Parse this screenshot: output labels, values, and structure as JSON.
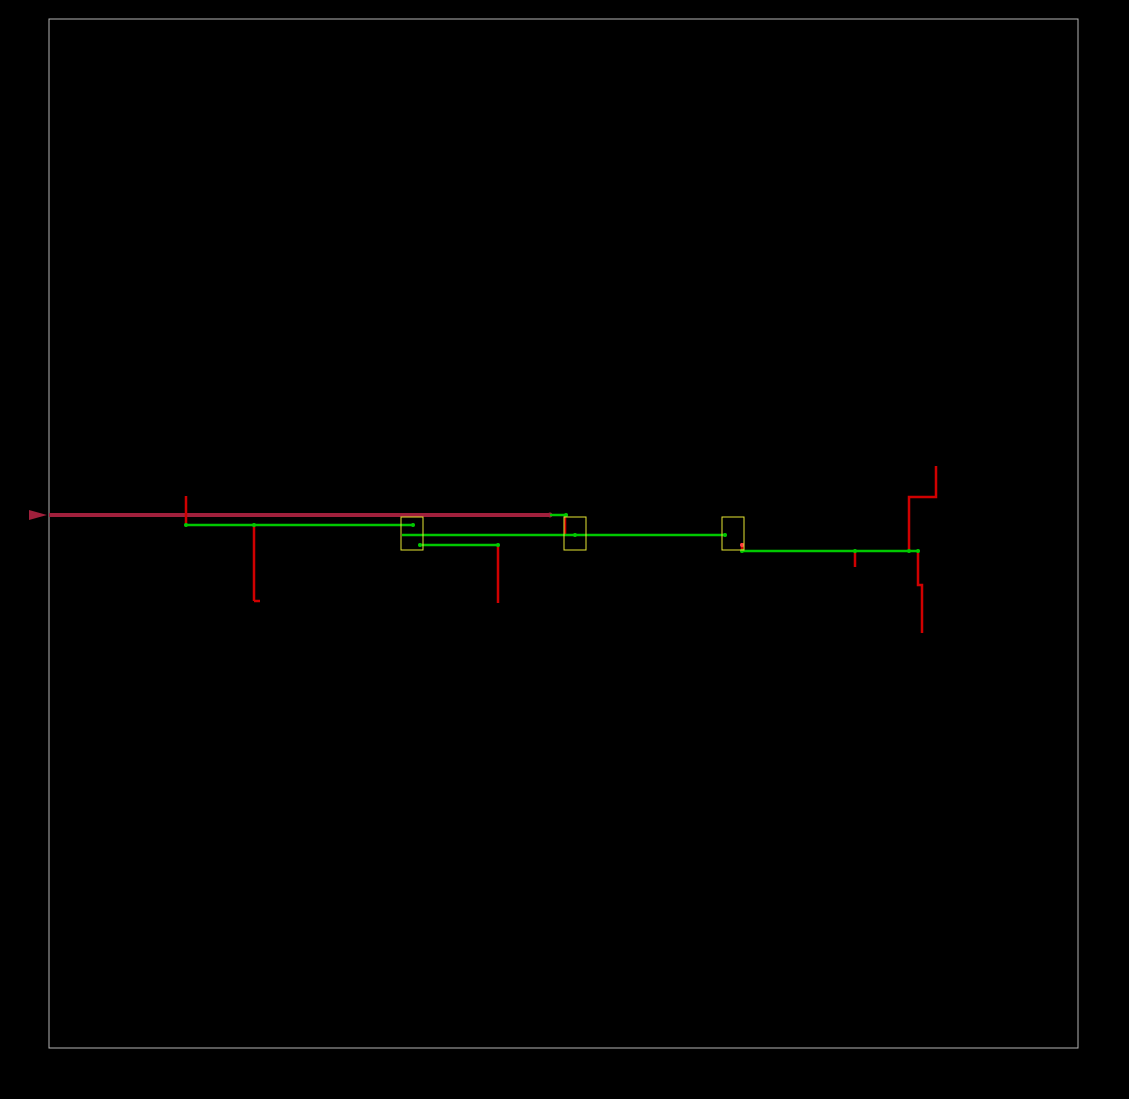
{
  "colors": {
    "background": "#000000",
    "frame": "#b4b4b4",
    "input_marker": "#a0203c",
    "input_trunk": "#a0203c",
    "metal1_red": "#d00000",
    "metal2_green": "#00c800",
    "cell_outline": "#e6e632",
    "via_dot": "#ff4040"
  },
  "icons": {
    "input_port": "triangle-arrow-icon"
  },
  "layers": [
    "input_trunk",
    "metal1_red",
    "metal2_green",
    "cell_outline"
  ]
}
